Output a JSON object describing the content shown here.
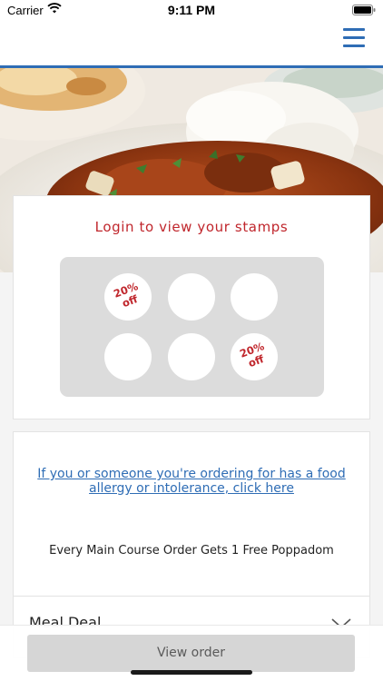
{
  "status_bar": {
    "carrier": "Carrier",
    "time": "9:11 PM"
  },
  "header": {
    "menu_icon": "hamburger-menu-icon",
    "accent_color": "#2f6db5"
  },
  "hero": {
    "image": "curry-with-rice-and-naan-photo"
  },
  "stamps": {
    "title": "Login to view your stamps",
    "items": [
      {
        "label": "20% off"
      },
      {
        "label": ""
      },
      {
        "label": ""
      },
      {
        "label": ""
      },
      {
        "label": ""
      },
      {
        "label": "20% off"
      }
    ]
  },
  "info": {
    "allergy_link": "If you or someone you're ordering for has a food allergy or intolerance, click here",
    "promo": "Every Main Course Order Gets 1 Free Poppadom"
  },
  "menu_sections": [
    {
      "label": "Meal Deal"
    }
  ],
  "footer": {
    "view_order_label": "View order"
  },
  "colors": {
    "brand_blue": "#2f6db5",
    "stamp_red": "#c0262c"
  }
}
